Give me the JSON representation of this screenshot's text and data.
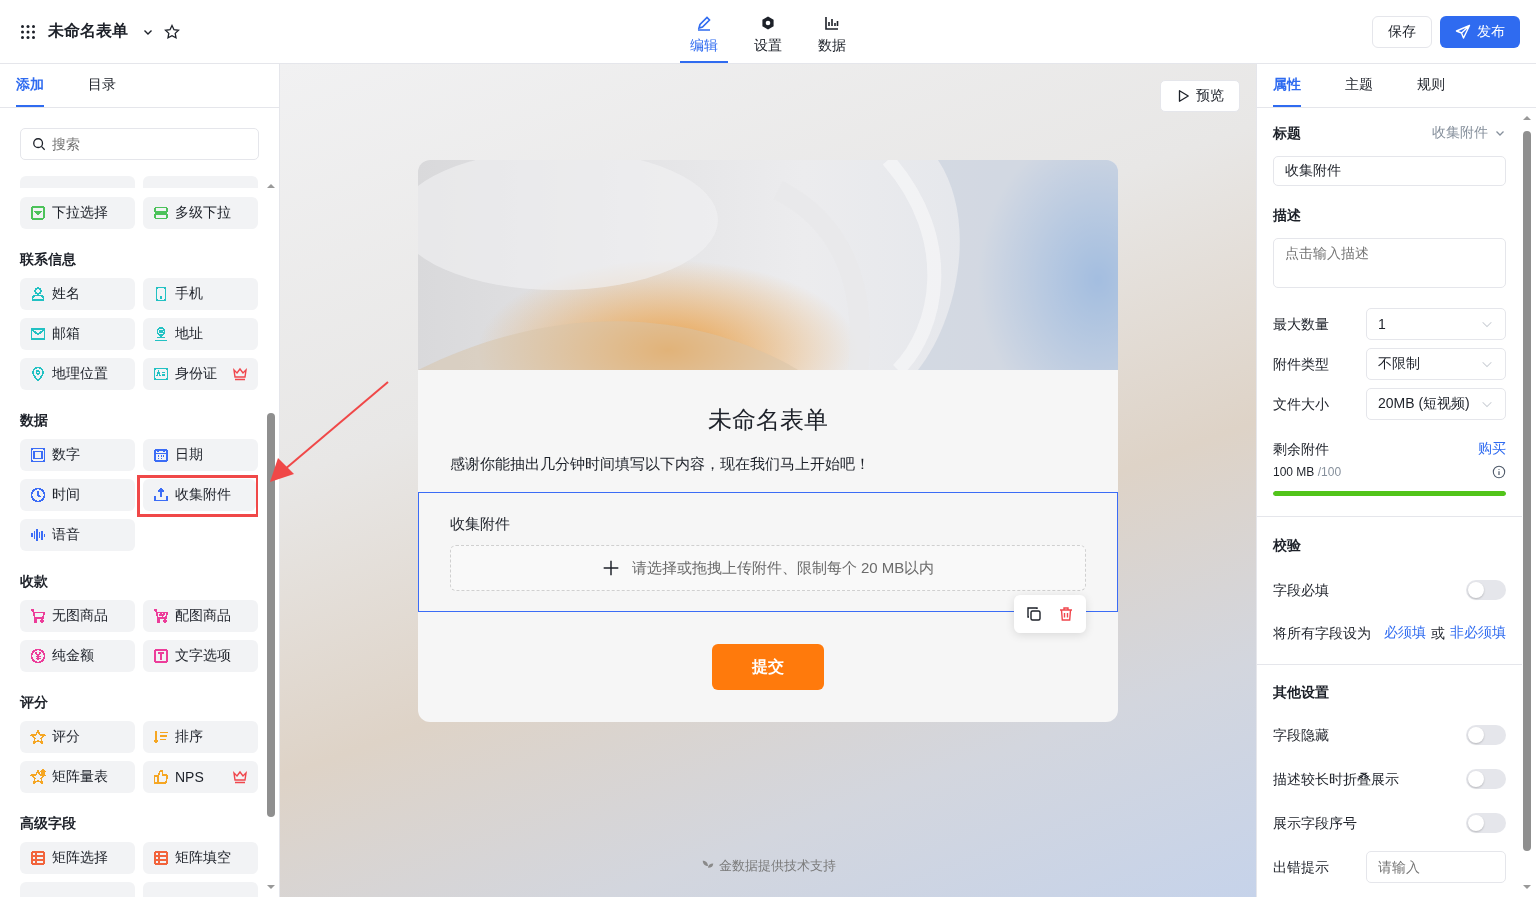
{
  "topbar": {
    "title": "未命名表单",
    "nav": [
      {
        "label": "编辑",
        "selected": true
      },
      {
        "label": "设置",
        "selected": false
      },
      {
        "label": "数据",
        "selected": false
      }
    ],
    "save": "保存",
    "publish": "发布"
  },
  "left_panel": {
    "tabs": [
      {
        "label": "添加",
        "selected": true
      },
      {
        "label": "目录",
        "selected": false
      }
    ],
    "search": {
      "placeholder": "搜索"
    },
    "sections": [
      {
        "color": "#4cc25a",
        "items": [
          {
            "label": "下拉选择",
            "premium": false,
            "highlighted": false
          },
          {
            "label": "多级下拉",
            "premium": false,
            "highlighted": false
          }
        ]
      },
      {
        "heading": "联系信息",
        "color": "#22c1c3",
        "items": [
          {
            "label": "姓名",
            "premium": false,
            "highlighted": false
          },
          {
            "label": "手机",
            "premium": false,
            "highlighted": false
          },
          {
            "label": "邮箱",
            "premium": false,
            "highlighted": false
          },
          {
            "label": "地址",
            "premium": false,
            "highlighted": false
          },
          {
            "label": "地理位置",
            "premium": false,
            "highlighted": false
          },
          {
            "label": "身份证",
            "premium": true,
            "highlighted": false
          }
        ]
      },
      {
        "heading": "数据",
        "color": "#3b6cf6",
        "items": [
          {
            "label": "数字",
            "premium": false,
            "highlighted": false
          },
          {
            "label": "日期",
            "premium": false,
            "highlighted": false
          },
          {
            "label": "时间",
            "premium": false,
            "highlighted": false
          },
          {
            "label": "收集附件",
            "premium": false,
            "highlighted": true
          },
          {
            "label": "语音",
            "premium": false,
            "highlighted": false
          }
        ]
      },
      {
        "heading": "收款",
        "color": "#ec3d9a",
        "items": [
          {
            "label": "无图商品",
            "premium": false,
            "highlighted": false
          },
          {
            "label": "配图商品",
            "premium": false,
            "highlighted": false
          },
          {
            "label": "纯金额",
            "premium": false,
            "highlighted": false
          },
          {
            "label": "文字选项",
            "premium": false,
            "highlighted": false
          }
        ]
      },
      {
        "heading": "评分",
        "color": "#f5a623",
        "items": [
          {
            "label": "评分",
            "premium": false,
            "highlighted": false
          },
          {
            "label": "排序",
            "premium": false,
            "highlighted": false
          },
          {
            "label": "矩阵量表",
            "premium": false,
            "highlighted": false
          },
          {
            "label": "NPS",
            "premium": true,
            "highlighted": false
          }
        ]
      },
      {
        "heading": "高级字段",
        "color": "#f2643c",
        "items": [
          {
            "label": "矩阵选择",
            "premium": false,
            "highlighted": false
          },
          {
            "label": "矩阵填空",
            "premium": false,
            "highlighted": false
          }
        ]
      }
    ]
  },
  "canvas": {
    "preview": "预览",
    "form": {
      "title": "未命名表单",
      "description": "感谢你能抽出几分钟时间填写以下内容，现在我们马上开始吧！",
      "field": {
        "label": "收集附件",
        "selected": true,
        "upload_hint": "请选择或拖拽上传附件、限制每个 20 MB以内"
      },
      "submit": "提交"
    },
    "footer": "金数据提供技术支持"
  },
  "right_panel": {
    "tabs": [
      {
        "label": "属性",
        "selected": true
      },
      {
        "label": "主题",
        "selected": false
      },
      {
        "label": "规则",
        "selected": false
      }
    ],
    "title_label": "标题",
    "title_type": "收集附件",
    "title_value": "收集附件",
    "desc_label": "描述",
    "desc_placeholder": "点击输入描述",
    "selects": [
      {
        "label": "最大数量",
        "value": "1"
      },
      {
        "label": "附件类型",
        "value": "不限制"
      },
      {
        "label": "文件大小",
        "value": "20MB (短视频)"
      }
    ],
    "quota": {
      "label": "剩余附件",
      "buy": "购买",
      "used": "100 MB",
      "total": "/100",
      "level": 1
    },
    "validation": {
      "heading": "校验",
      "toggles": [
        {
          "label": "字段必填",
          "on": false
        }
      ],
      "bulk": {
        "prefix": "将所有字段设为",
        "required": "必须填",
        "or": "或",
        "optional": "非必须填"
      }
    },
    "other": {
      "heading": "其他设置",
      "toggles": [
        {
          "label": "字段隐藏",
          "on": false
        },
        {
          "label": "描述较长时折叠展示",
          "on": false
        },
        {
          "label": "展示字段序号",
          "on": false
        }
      ],
      "error": {
        "label": "出错提示",
        "placeholder": "请输入"
      }
    }
  }
}
